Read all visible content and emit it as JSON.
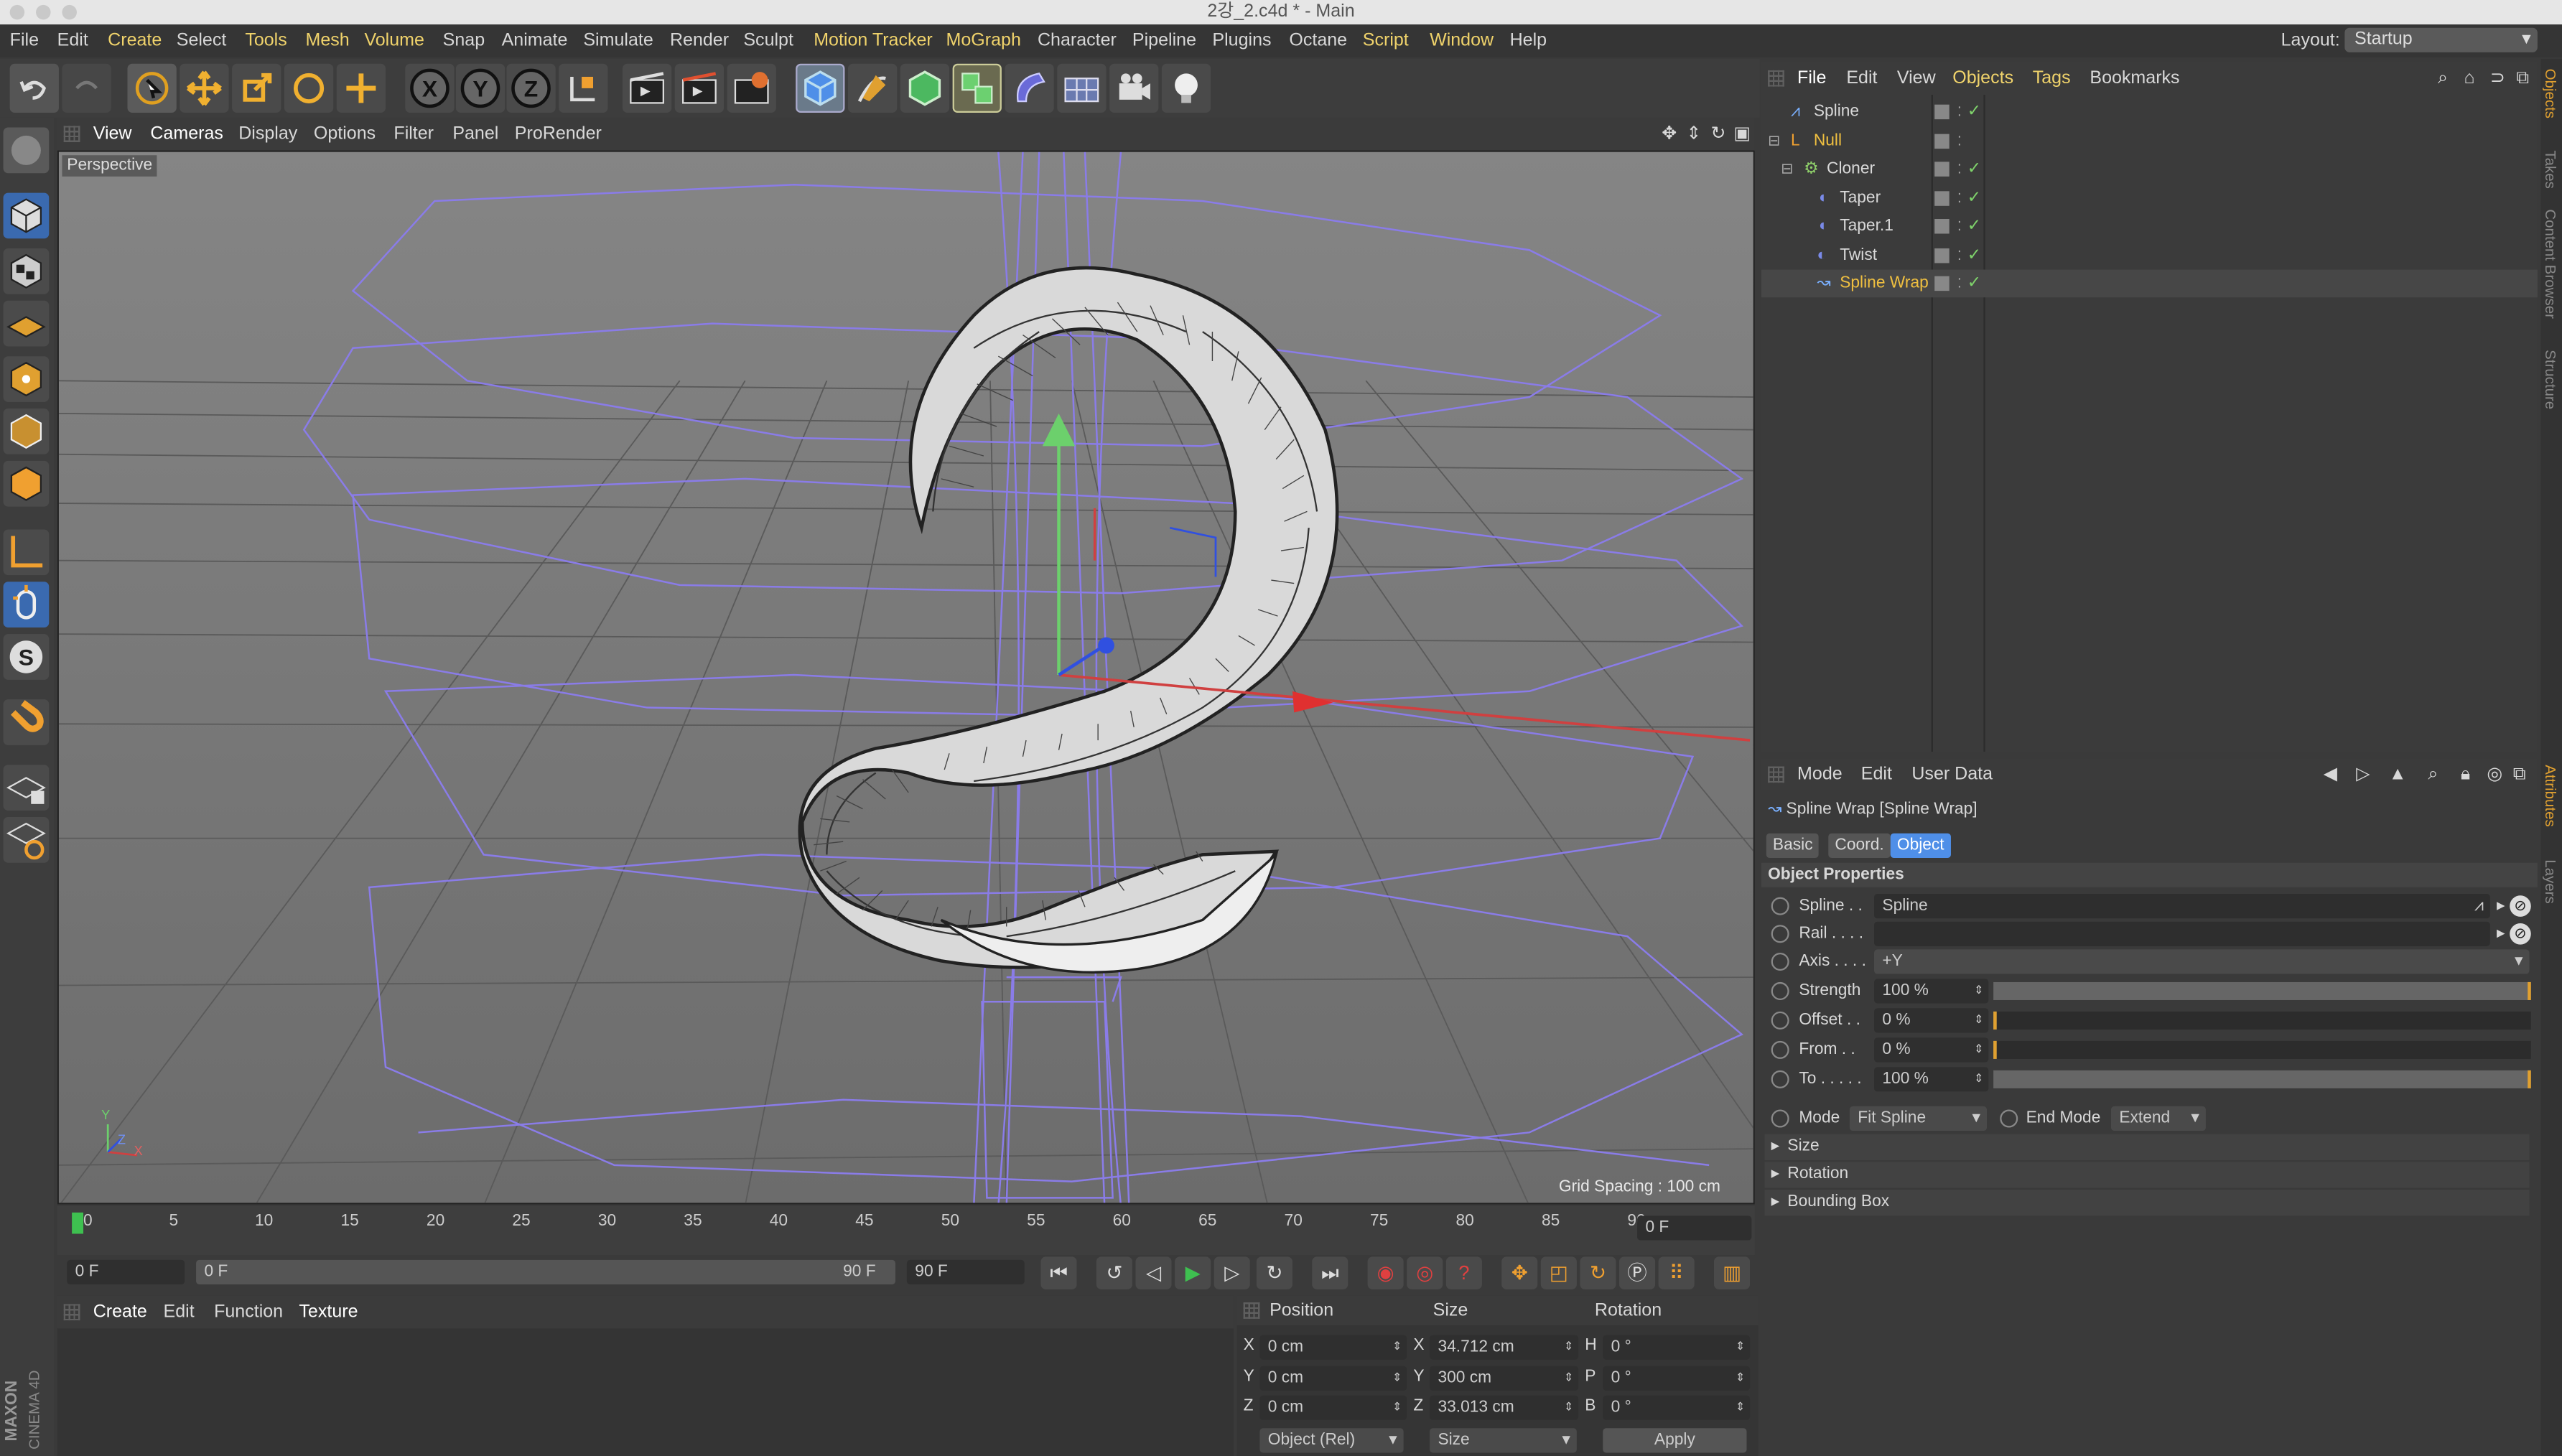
{
  "window_title": "2강_2.c4d * - Main",
  "menu": [
    "File",
    "Edit",
    "Create",
    "Select",
    "Tools",
    "Mesh",
    "Volume",
    "Snap",
    "Animate",
    "Simulate",
    "Render",
    "Sculpt",
    "Motion Tracker",
    "MoGraph",
    "Character",
    "Pipeline",
    "Plugins",
    "Octane",
    "Script",
    "Window",
    "Help"
  ],
  "layout": {
    "label": "Layout:",
    "value": "Startup"
  },
  "viewport": {
    "menu": [
      "View",
      "Cameras",
      "Display",
      "Options",
      "Filter",
      "Panel",
      "ProRender"
    ],
    "label": "Perspective",
    "grid_spacing": "Grid Spacing : 100 cm",
    "axis_y": "Y",
    "axis_z": "Z",
    "axis_x": "X"
  },
  "timeline": {
    "ticks": [
      "0",
      "5",
      "10",
      "15",
      "20",
      "25",
      "30",
      "35",
      "40",
      "45",
      "50",
      "55",
      "60",
      "65",
      "70",
      "75",
      "80",
      "85",
      "90"
    ],
    "current": "0 F",
    "start": "0 F",
    "range_start": "0 F",
    "range_end": "90 F",
    "end": "90 F"
  },
  "material_panel": {
    "menu": [
      "Create",
      "Edit",
      "Function",
      "Texture"
    ]
  },
  "coord_panel": {
    "headers": [
      "Position",
      "Size",
      "Rotation"
    ],
    "rows": [
      {
        "axis": "X",
        "pos": "0 cm",
        "size_axis": "X",
        "size": "34.712 cm",
        "rot_axis": "H",
        "rot": "0 °"
      },
      {
        "axis": "Y",
        "pos": "0 cm",
        "size_axis": "Y",
        "size": "300 cm",
        "rot_axis": "P",
        "rot": "0 °"
      },
      {
        "axis": "Z",
        "pos": "0 cm",
        "size_axis": "Z",
        "size": "33.013 cm",
        "rot_axis": "B",
        "rot": "0 °"
      }
    ],
    "mode": "Object (Rel)",
    "size_mode": "Size",
    "apply": "Apply"
  },
  "object_panel": {
    "menu": [
      "File",
      "Edit",
      "View",
      "Objects",
      "Tags",
      "Bookmarks"
    ],
    "objects": [
      {
        "name": "Spline",
        "indent": 0
      },
      {
        "name": "Null",
        "indent": 0
      },
      {
        "name": "Cloner",
        "indent": 1
      },
      {
        "name": "Taper",
        "indent": 2
      },
      {
        "name": "Taper.1",
        "indent": 2
      },
      {
        "name": "Twist",
        "indent": 2
      },
      {
        "name": "Spline Wrap",
        "indent": 2
      }
    ]
  },
  "attr_panel": {
    "menu": [
      "Mode",
      "Edit",
      "User Data"
    ],
    "title": "Spline Wrap [Spline Wrap]",
    "tabs": [
      "Basic",
      "Coord.",
      "Object"
    ],
    "section": "Object Properties",
    "spline_label": "Spline . .",
    "spline_value": "Spline",
    "rail_label": "Rail . . . .",
    "axis_label": "Axis . . . .",
    "axis_value": "+Y",
    "strength_label": "Strength",
    "strength_value": "100 %",
    "offset_label": "Offset . .",
    "offset_value": "0 %",
    "from_label": "From . .",
    "from_value": "0 %",
    "to_label": "To . . . . .",
    "to_value": "100 %",
    "strength_fraction": 1.0,
    "offset_fraction": 0.0,
    "from_fraction": 0.0,
    "to_fraction": 1.0,
    "mode_label": "Mode",
    "mode_value": "Fit Spline",
    "endmode_label": "End Mode",
    "endmode_value": "Extend",
    "sections": [
      "Size",
      "Rotation",
      "Bounding Box"
    ]
  },
  "right_tabs": [
    "Objects",
    "Takes",
    "Content Browser",
    "Structure",
    "Attributes",
    "Layers"
  ],
  "brand": [
    "MAXON",
    "CINEMA 4D"
  ],
  "colors": {
    "highlight": "#f0d36b",
    "accent_blue": "#4f8fe8",
    "check_green": "#7fd36b"
  }
}
